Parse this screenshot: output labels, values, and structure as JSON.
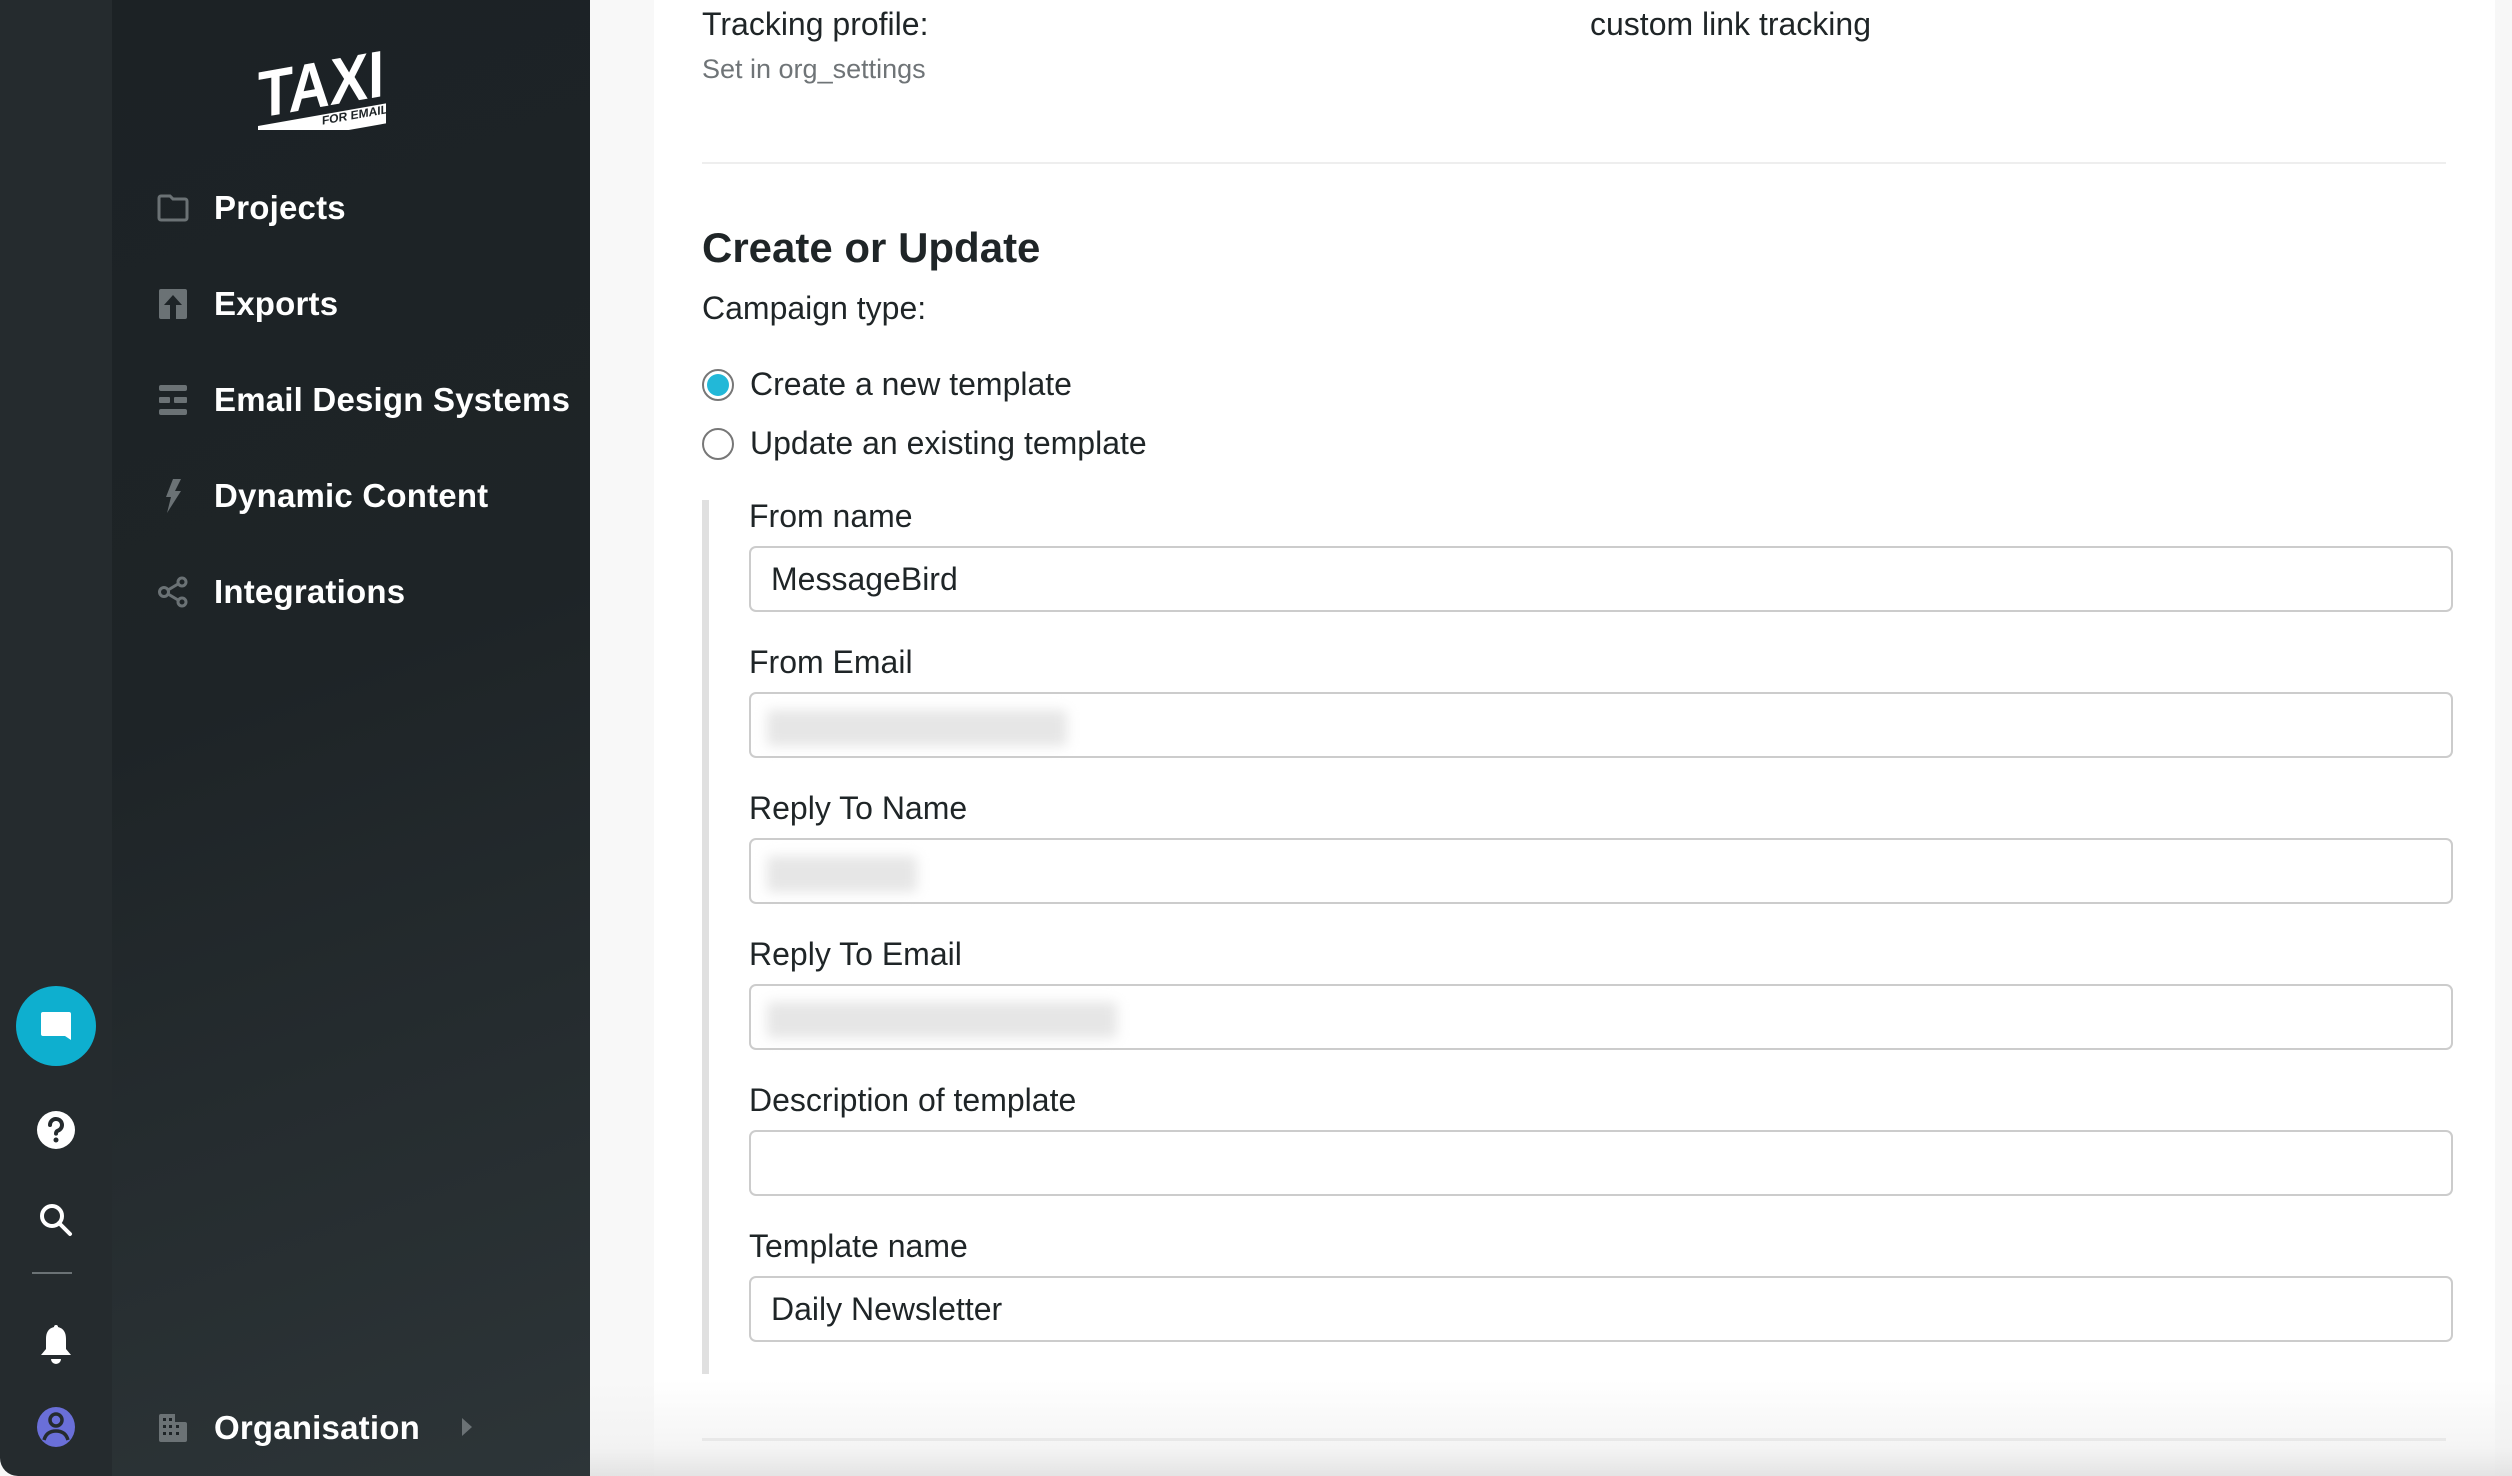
{
  "app": {
    "logo_text": "TAXI",
    "logo_subtext": "FOR EMAIL"
  },
  "sidebar": {
    "items": [
      {
        "label": "Projects",
        "icon": "folder-icon"
      },
      {
        "label": "Exports",
        "icon": "export-icon"
      },
      {
        "label": "Email Design Systems",
        "icon": "design-system-icon"
      },
      {
        "label": "Dynamic Content",
        "icon": "lightning-icon"
      },
      {
        "label": "Integrations",
        "icon": "share-icon"
      }
    ],
    "organisation": {
      "label": "Organisation",
      "icon": "building-icon"
    }
  },
  "rail": {
    "icons": [
      "chat-icon",
      "help-icon",
      "search-icon",
      "bell-icon",
      "user-avatar-icon"
    ],
    "chat_color": "#0eafcf",
    "avatar_color": "#6a6fd8"
  },
  "tracking": {
    "label": "Tracking profile:",
    "sublabel": "Set in org_settings",
    "value": "custom link tracking"
  },
  "form": {
    "title": "Create or Update",
    "campaign_type_label": "Campaign type:",
    "options": [
      {
        "label": "Create a new template",
        "checked": true
      },
      {
        "label": "Update an existing template",
        "checked": false
      }
    ],
    "fields": {
      "from_name": {
        "label": "From name",
        "value": "MessageBird"
      },
      "from_email": {
        "label": "From Email",
        "value": "[redacted]"
      },
      "reply_to_name": {
        "label": "Reply To Name",
        "value": "[redacted]"
      },
      "reply_to_email": {
        "label": "Reply To Email",
        "value": "[redacted]"
      },
      "description": {
        "label": "Description of template",
        "value": ""
      },
      "template_name": {
        "label": "Template name",
        "value": "Daily Newsletter"
      }
    }
  },
  "colors": {
    "accent": "#22b8d8",
    "sidebar_bg": "#1e2427",
    "rail_bg": "#252b2e"
  }
}
